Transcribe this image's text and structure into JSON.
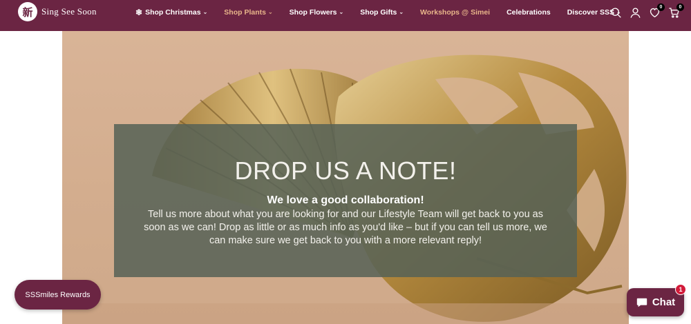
{
  "brand": {
    "logo_glyph": "新",
    "name": "Sing See Soon",
    "color": "#6b2543"
  },
  "nav": [
    {
      "label": "Shop Christmas",
      "has_dropdown": true,
      "icon": "snowflake-icon"
    },
    {
      "label": "Shop Plants",
      "has_dropdown": true,
      "highlight": true
    },
    {
      "label": "Shop Flowers",
      "has_dropdown": true
    },
    {
      "label": "Shop Gifts",
      "has_dropdown": true
    },
    {
      "label": "Workshops @ Simei",
      "highlight": true
    },
    {
      "label": "Celebrations"
    },
    {
      "label": "Discover SSS",
      "has_dropdown": true
    }
  ],
  "header_icons": {
    "search": "search-icon",
    "account": "user-icon",
    "wishlist": "heart-icon",
    "wishlist_count": "0",
    "cart": "cart-icon",
    "cart_count": "0"
  },
  "hero": {
    "title": "DROP US A NOTE!",
    "subtitle": "We love a good collaboration!",
    "body": "Tell us more about what you are looking for and our Lifestyle Team will get back to you as soon as we can! Drop as little or as much info as you'd like – but if you can tell us more, we can make sure we get back to you with a more relevant reply!"
  },
  "rewards": {
    "label": "SSSmiles Rewards"
  },
  "chat": {
    "label": "Chat",
    "badge": "1"
  }
}
